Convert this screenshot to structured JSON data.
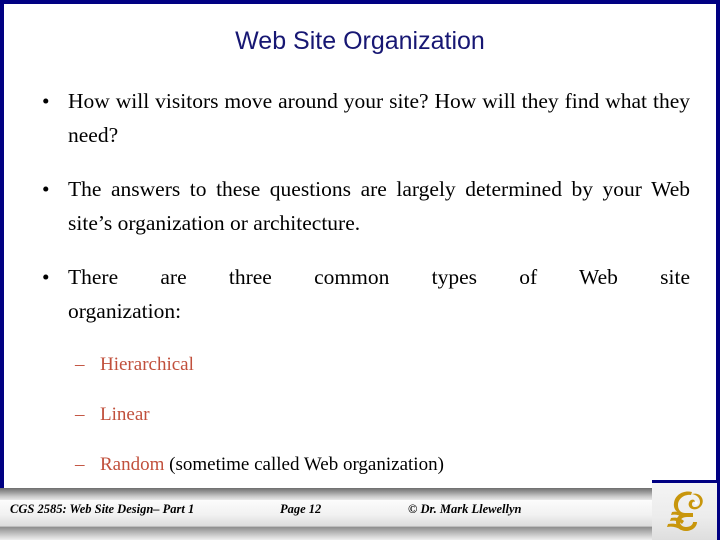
{
  "slide": {
    "title": "Web Site Organization",
    "title_color": "#171773",
    "frame_color": "#000082",
    "accent_red": "#C1503C",
    "bullet_glyph": "•",
    "dash_glyph": "–",
    "bullets": [
      {
        "text": "How will visitors move around your site?  How will they find what they need?"
      },
      {
        "text": "The answers to these questions are largely determined by your Web site’s organization or architecture."
      },
      {
        "line1": "There are three common types of Web site",
        "line2": "organization:"
      }
    ],
    "sub_bullets": [
      {
        "keyword": "Hierarchical",
        "rest": ""
      },
      {
        "keyword": "Linear",
        "rest": ""
      },
      {
        "keyword": "Random",
        "rest": " (sometime called Web organization)"
      }
    ]
  },
  "footer": {
    "course": "CGS 2585: Web Site Design– Part 1",
    "page": "Page 12",
    "copyright": "© Dr. Mark Llewellyn",
    "logo_name": "ucf-pegasus-logo",
    "logo_color": "#C8960C"
  }
}
